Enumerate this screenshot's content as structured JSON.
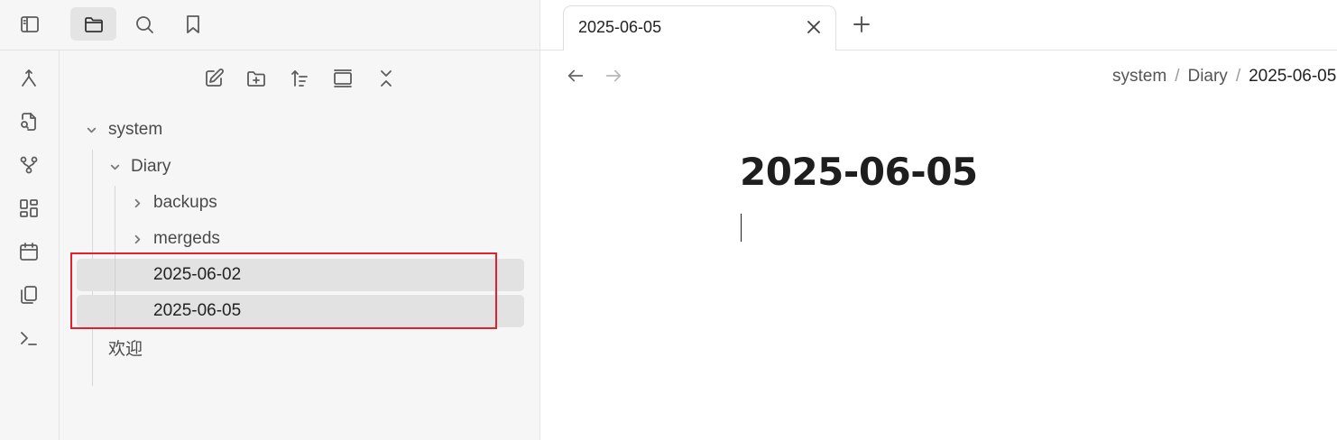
{
  "app": {
    "top_icons": [
      "sidebar-toggle-icon",
      "folder-icon",
      "search-icon",
      "bookmark-icon"
    ]
  },
  "ribbon": {
    "icons": [
      "merge-icon",
      "file-search-icon",
      "graph-icon",
      "dashboard-icon",
      "calendar-icon",
      "copy-icon",
      "terminal-icon"
    ]
  },
  "explorer": {
    "toolbar_icons": [
      "new-note-icon",
      "new-folder-icon",
      "sort-icon",
      "collapse-view-icon",
      "collapse-all-icon"
    ],
    "tree": {
      "system": "system",
      "diary": "Diary",
      "backups": "backups",
      "mergeds": "mergeds",
      "file1": "2025-06-02",
      "file2": "2025-06-05",
      "welcome": "欢迎"
    }
  },
  "tabs": {
    "active_title": "2025-06-05"
  },
  "breadcrumb": {
    "part1": "system",
    "part2": "Diary",
    "current": "2025-06-05",
    "separator": "/"
  },
  "document": {
    "title": "2025-06-05"
  },
  "colors": {
    "highlight": "#e0212e",
    "sidebar_bg": "#f6f6f6",
    "selected_bg": "#e2e2e2"
  }
}
